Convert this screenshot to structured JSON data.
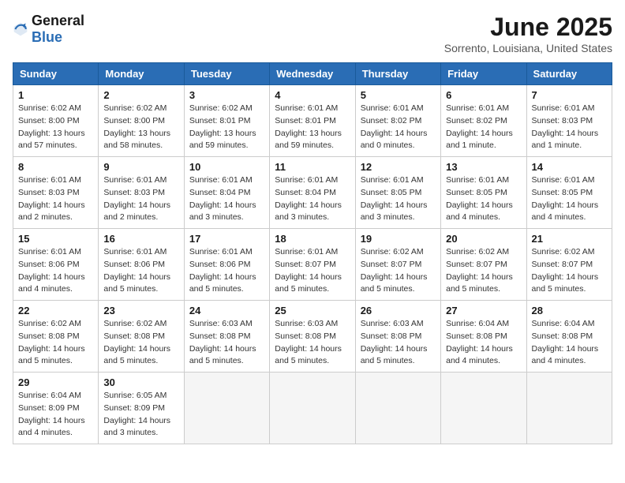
{
  "header": {
    "logo_general": "General",
    "logo_blue": "Blue",
    "title": "June 2025",
    "subtitle": "Sorrento, Louisiana, United States"
  },
  "weekdays": [
    "Sunday",
    "Monday",
    "Tuesday",
    "Wednesday",
    "Thursday",
    "Friday",
    "Saturday"
  ],
  "weeks": [
    [
      {
        "day": "1",
        "sunrise": "6:02 AM",
        "sunset": "8:00 PM",
        "daylight": "13 hours and 57 minutes."
      },
      {
        "day": "2",
        "sunrise": "6:02 AM",
        "sunset": "8:00 PM",
        "daylight": "13 hours and 58 minutes."
      },
      {
        "day": "3",
        "sunrise": "6:02 AM",
        "sunset": "8:01 PM",
        "daylight": "13 hours and 59 minutes."
      },
      {
        "day": "4",
        "sunrise": "6:01 AM",
        "sunset": "8:01 PM",
        "daylight": "13 hours and 59 minutes."
      },
      {
        "day": "5",
        "sunrise": "6:01 AM",
        "sunset": "8:02 PM",
        "daylight": "14 hours and 0 minutes."
      },
      {
        "day": "6",
        "sunrise": "6:01 AM",
        "sunset": "8:02 PM",
        "daylight": "14 hours and 1 minute."
      },
      {
        "day": "7",
        "sunrise": "6:01 AM",
        "sunset": "8:03 PM",
        "daylight": "14 hours and 1 minute."
      }
    ],
    [
      {
        "day": "8",
        "sunrise": "6:01 AM",
        "sunset": "8:03 PM",
        "daylight": "14 hours and 2 minutes."
      },
      {
        "day": "9",
        "sunrise": "6:01 AM",
        "sunset": "8:03 PM",
        "daylight": "14 hours and 2 minutes."
      },
      {
        "day": "10",
        "sunrise": "6:01 AM",
        "sunset": "8:04 PM",
        "daylight": "14 hours and 3 minutes."
      },
      {
        "day": "11",
        "sunrise": "6:01 AM",
        "sunset": "8:04 PM",
        "daylight": "14 hours and 3 minutes."
      },
      {
        "day": "12",
        "sunrise": "6:01 AM",
        "sunset": "8:05 PM",
        "daylight": "14 hours and 3 minutes."
      },
      {
        "day": "13",
        "sunrise": "6:01 AM",
        "sunset": "8:05 PM",
        "daylight": "14 hours and 4 minutes."
      },
      {
        "day": "14",
        "sunrise": "6:01 AM",
        "sunset": "8:05 PM",
        "daylight": "14 hours and 4 minutes."
      }
    ],
    [
      {
        "day": "15",
        "sunrise": "6:01 AM",
        "sunset": "8:06 PM",
        "daylight": "14 hours and 4 minutes."
      },
      {
        "day": "16",
        "sunrise": "6:01 AM",
        "sunset": "8:06 PM",
        "daylight": "14 hours and 5 minutes."
      },
      {
        "day": "17",
        "sunrise": "6:01 AM",
        "sunset": "8:06 PM",
        "daylight": "14 hours and 5 minutes."
      },
      {
        "day": "18",
        "sunrise": "6:01 AM",
        "sunset": "8:07 PM",
        "daylight": "14 hours and 5 minutes."
      },
      {
        "day": "19",
        "sunrise": "6:02 AM",
        "sunset": "8:07 PM",
        "daylight": "14 hours and 5 minutes."
      },
      {
        "day": "20",
        "sunrise": "6:02 AM",
        "sunset": "8:07 PM",
        "daylight": "14 hours and 5 minutes."
      },
      {
        "day": "21",
        "sunrise": "6:02 AM",
        "sunset": "8:07 PM",
        "daylight": "14 hours and 5 minutes."
      }
    ],
    [
      {
        "day": "22",
        "sunrise": "6:02 AM",
        "sunset": "8:08 PM",
        "daylight": "14 hours and 5 minutes."
      },
      {
        "day": "23",
        "sunrise": "6:02 AM",
        "sunset": "8:08 PM",
        "daylight": "14 hours and 5 minutes."
      },
      {
        "day": "24",
        "sunrise": "6:03 AM",
        "sunset": "8:08 PM",
        "daylight": "14 hours and 5 minutes."
      },
      {
        "day": "25",
        "sunrise": "6:03 AM",
        "sunset": "8:08 PM",
        "daylight": "14 hours and 5 minutes."
      },
      {
        "day": "26",
        "sunrise": "6:03 AM",
        "sunset": "8:08 PM",
        "daylight": "14 hours and 5 minutes."
      },
      {
        "day": "27",
        "sunrise": "6:04 AM",
        "sunset": "8:08 PM",
        "daylight": "14 hours and 4 minutes."
      },
      {
        "day": "28",
        "sunrise": "6:04 AM",
        "sunset": "8:08 PM",
        "daylight": "14 hours and 4 minutes."
      }
    ],
    [
      {
        "day": "29",
        "sunrise": "6:04 AM",
        "sunset": "8:09 PM",
        "daylight": "14 hours and 4 minutes."
      },
      {
        "day": "30",
        "sunrise": "6:05 AM",
        "sunset": "8:09 PM",
        "daylight": "14 hours and 3 minutes."
      },
      null,
      null,
      null,
      null,
      null
    ]
  ],
  "labels": {
    "sunrise": "Sunrise: ",
    "sunset": "Sunset: ",
    "daylight": "Daylight: "
  }
}
